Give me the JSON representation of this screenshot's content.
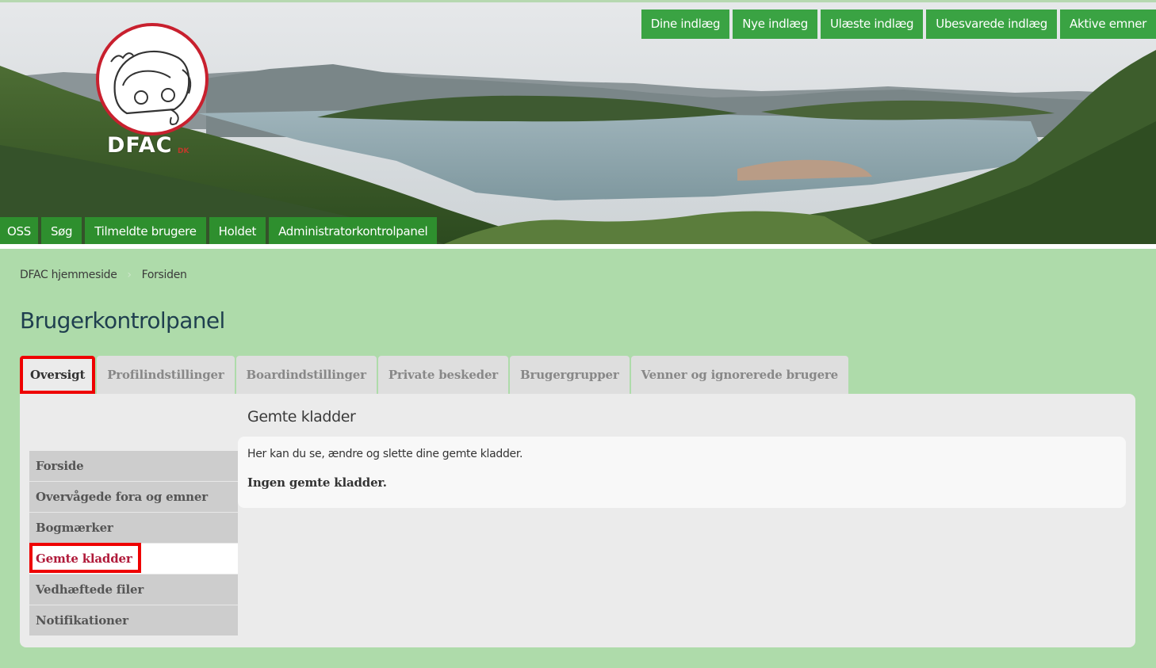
{
  "header": {
    "logo_text": "DFAC",
    "logo_small": "DK",
    "quicklinks": [
      {
        "label": "Dine indlæg"
      },
      {
        "label": "Nye indlæg"
      },
      {
        "label": "Ulæste indlæg"
      },
      {
        "label": "Ubesvarede indlæg"
      },
      {
        "label": "Aktive emner"
      }
    ],
    "nav": [
      {
        "label": "OSS"
      },
      {
        "label": "Søg"
      },
      {
        "label": "Tilmeldte brugere"
      },
      {
        "label": "Holdet"
      },
      {
        "label": "Administratorkontrolpanel"
      }
    ]
  },
  "breadcrumb": {
    "items": [
      {
        "label": "DFAC hjemmeside"
      },
      {
        "label": "Forsiden"
      }
    ]
  },
  "page": {
    "title": "Brugerkontrolpanel"
  },
  "tabs": [
    {
      "label": "Oversigt",
      "active": true
    },
    {
      "label": "Profilindstillinger",
      "active": false
    },
    {
      "label": "Boardindstillinger",
      "active": false
    },
    {
      "label": "Private beskeder",
      "active": false
    },
    {
      "label": "Brugergrupper",
      "active": false
    },
    {
      "label": "Venner og ignorerede brugere",
      "active": false
    }
  ],
  "sidemenu": [
    {
      "label": "Forside",
      "active": false
    },
    {
      "label": "Overvågede fora og emner",
      "active": false
    },
    {
      "label": "Bogmærker",
      "active": false
    },
    {
      "label": "Gemte kladder",
      "active": true
    },
    {
      "label": "Vedhæftede filer",
      "active": false
    },
    {
      "label": "Notifikationer",
      "active": false
    }
  ],
  "content": {
    "section_title": "Gemte kladder",
    "description": "Her kan du se, ændre og slette dine gemte kladder.",
    "empty_message": "Ingen gemte kladder."
  },
  "colors": {
    "background": "#aedbaa",
    "quicklink_green": "#3aa343",
    "nav_green": "#2e8f2e",
    "highlight_red": "#ee0000",
    "active_menu_text": "#b01a3a"
  }
}
